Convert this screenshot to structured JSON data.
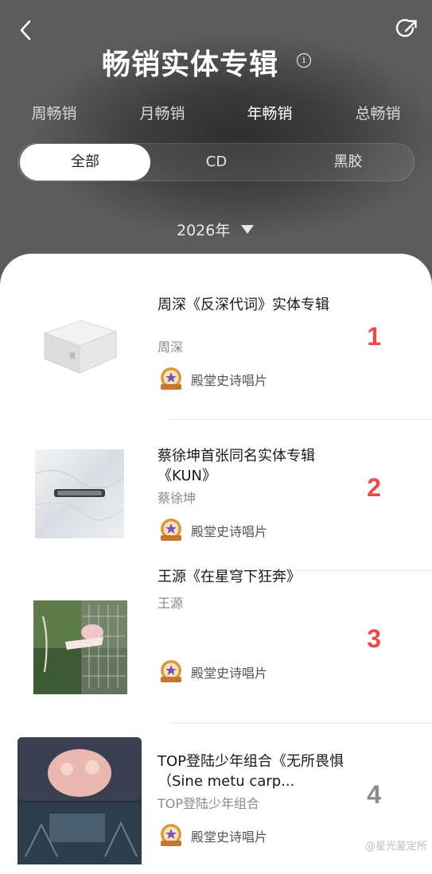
{
  "header": {
    "title": "畅销实体专辑",
    "period_tabs": [
      "周畅销",
      "月畅销",
      "年畅销",
      "总畅销"
    ],
    "active_period": "年畅销",
    "type_tabs": [
      "全部",
      "CD",
      "黑胶"
    ],
    "active_type": "全部",
    "year": "2026年"
  },
  "colors": {
    "rank_top": "#e94b4b",
    "rank_other": "#8c8c8c",
    "badge_gold": "#d79a3f",
    "badge_purple": "#7a52b8"
  },
  "items": [
    {
      "title": "周深《反深代词》实体专辑",
      "artist": "周深",
      "badge": "殿堂史诗唱片",
      "rank": "1"
    },
    {
      "title": "蔡徐坤首张同名实体专辑《KUN》",
      "artist": "蔡徐坤",
      "badge": "殿堂史诗唱片",
      "rank": "2"
    },
    {
      "title": "王源《在星穹下狂奔》",
      "artist": "王源",
      "badge": "殿堂史诗唱片",
      "rank": "3"
    },
    {
      "title": "TOP登陆少年组合《无所畏惧（Sine metu carp...",
      "artist": "TOP登陆少年组合",
      "badge": "殿堂史诗唱片",
      "rank": "4"
    }
  ],
  "watermark": "@星光鉴定所"
}
